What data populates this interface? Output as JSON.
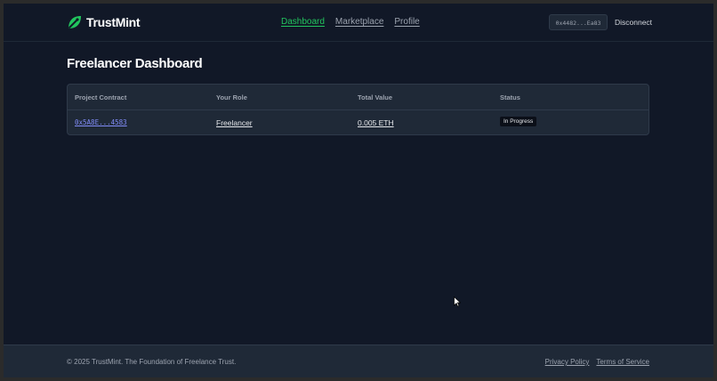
{
  "header": {
    "logo_text": "TrustMint",
    "nav": [
      {
        "label": "Dashboard",
        "active": true
      },
      {
        "label": "Marketplace",
        "active": false
      },
      {
        "label": "Profile",
        "active": false
      }
    ],
    "wallet_address": "0x4482...Ea83",
    "disconnect_label": "Disconnect"
  },
  "main": {
    "title": "Freelancer Dashboard",
    "table": {
      "columns": [
        "Project Contract",
        "Your Role",
        "Total Value",
        "Status"
      ],
      "rows": [
        {
          "contract": "0x5A8E...4583",
          "role": "Freelancer",
          "value": "0.005 ETH",
          "status": "In Progress"
        }
      ]
    }
  },
  "footer": {
    "copyright": "© 2025 TrustMint. The Foundation of Freelance Trust.",
    "links": [
      "Privacy Policy",
      "Terms of Service"
    ]
  },
  "colors": {
    "background": "#111827",
    "surface": "#1f2937",
    "accent": "#22c55e",
    "link_mono": "#818cf8"
  },
  "icons": {
    "logo": "leaf-mint-icon",
    "cursor": "mouse-pointer-icon"
  }
}
